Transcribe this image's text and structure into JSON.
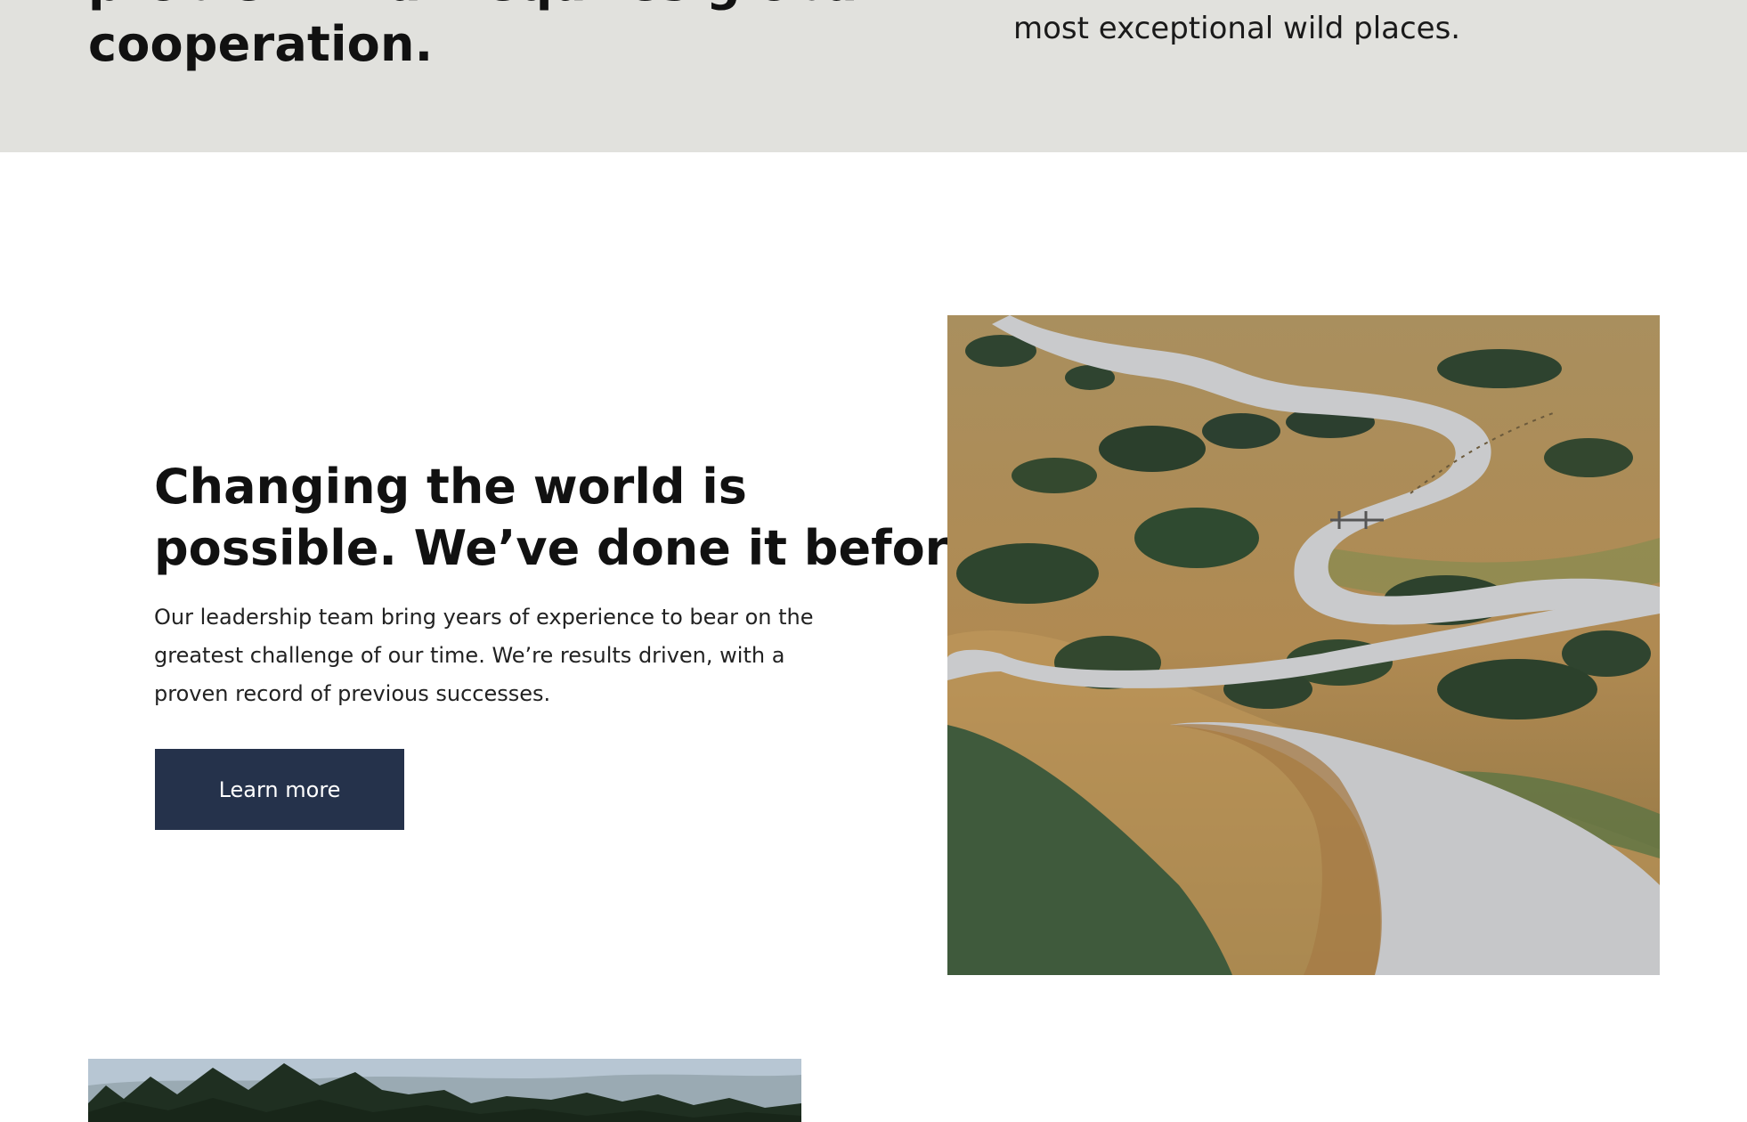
{
  "intro_band": {
    "headline_lines": [
      "problem that requires global",
      "cooperation."
    ],
    "subtext": "most exceptional wild places."
  },
  "feature": {
    "heading_lines": [
      "Changing the world is",
      "possible. We’ve done it before."
    ],
    "body_lines": [
      "Our leadership team bring years of experience to bear on the",
      "greatest challenge of our time. We’re results driven, with a",
      "proven record of previous successes."
    ],
    "button_label": "Learn more"
  },
  "images": {
    "feature_image": "winding-gravel-road-through-grassy-hills-photo",
    "next_section_image": "forest-treeline-photo"
  },
  "colors": {
    "band_background": "#e1e1dd",
    "button_background": "#25324b",
    "button_text": "#ffffff",
    "text": "#111111"
  }
}
